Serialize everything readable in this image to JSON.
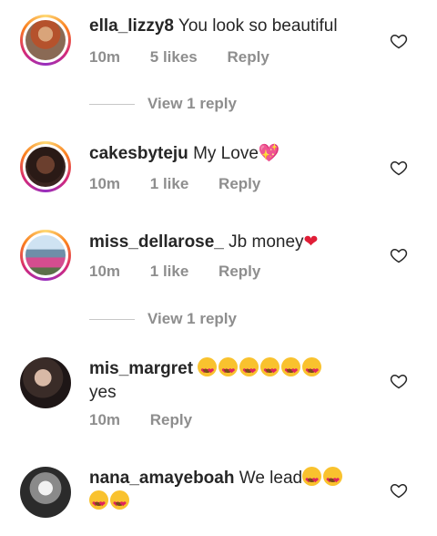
{
  "comments": [
    {
      "username": "ella_lizzy8",
      "text": " You look so beautiful",
      "time": "10m",
      "likes": "5 likes",
      "reply": "Reply",
      "view_replies": "View 1 reply"
    },
    {
      "username": "cakesbyteju",
      "text": " My Love",
      "trailing_glyph": "💖",
      "time": "10m",
      "likes": "1 like",
      "reply": "Reply"
    },
    {
      "username": "miss_dellarose_",
      "text": " Jb money",
      "trailing_glyph": "❤",
      "time": "10m",
      "likes": "1 like",
      "reply": "Reply",
      "view_replies": "View 1 reply"
    },
    {
      "username": "mis_margret",
      "emoji_count": 6,
      "text_line2": "yes",
      "time": "10m",
      "reply": "Reply"
    },
    {
      "username": "nana_amayeboah",
      "text": " We lead",
      "emoji_count": 4
    }
  ],
  "icons": {
    "like": "heart-outline-icon"
  },
  "colors": {
    "text": "#262626",
    "meta": "#8e8e8e",
    "story_ring": "#d62976"
  }
}
